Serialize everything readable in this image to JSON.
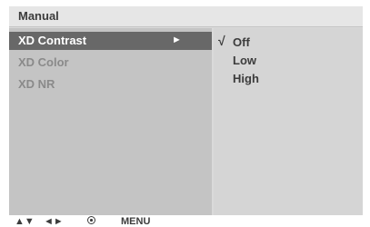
{
  "title": "Manual",
  "menu": {
    "items": [
      {
        "label": "XD Contrast",
        "selected": true,
        "arrow": "►"
      },
      {
        "label": "XD Color",
        "selected": false
      },
      {
        "label": "XD NR",
        "selected": false
      }
    ]
  },
  "options": {
    "check_mark": "√",
    "items": [
      {
        "label": "Off",
        "checked": true
      },
      {
        "label": "Low",
        "checked": false
      },
      {
        "label": "High",
        "checked": false
      }
    ]
  },
  "hints": {
    "navigate": "▲▼",
    "lr": "◄►",
    "enter_icon": "enter-icon",
    "menu": "MENU"
  },
  "colors": {
    "selected_bg": "#686868",
    "selected_text": "#ffffff",
    "inactive_text": "#8a8a8a"
  }
}
